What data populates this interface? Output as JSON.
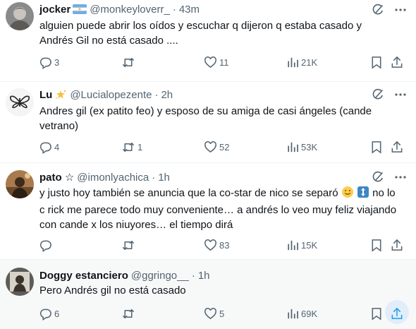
{
  "tweets": [
    {
      "name": "jocker",
      "handle": "@monkeyloverr_",
      "time": "43m",
      "text_lines": [
        "alguien puede abrir los oídos y escuchar q dijeron q estaba casado y",
        "Andrés Gil no está casado ...."
      ],
      "replies": "3",
      "reposts": "",
      "likes": "11",
      "views": "21K",
      "badge_icon": "argentina-flag-icon"
    },
    {
      "name": "Lu",
      "handle": "@Lucialopezente",
      "time": "2h",
      "text_lines": [
        "Andres gil (ex patito feo) y esposo de su amiga de casi ángeles (cande",
        "vetrano)"
      ],
      "replies": "4",
      "reposts": "1",
      "likes": "52",
      "views": "53K",
      "badge_icon": "sparkle-star-icon"
    },
    {
      "name": "pato ☆",
      "handle": "@imonlyachica",
      "time": "1h",
      "text_line1_prefix": "y justo hoy también se anuncia que la co-star de nico se separó",
      "text_line1_suffix": "no lo",
      "text_lines_rest": [
        "c rick me parece todo muy conveniente… a andrés lo veo muy feliz viajando",
        "con cande x los niuyores… el tiempo dirá"
      ],
      "replies": "",
      "reposts": "",
      "likes": "83",
      "views": "15K"
    },
    {
      "name": "Doggy estanciero",
      "handle": "@ggringo__",
      "time": "1h",
      "text_lines": [
        "Pero Andrés gil no está casado"
      ],
      "replies": "6",
      "reposts": "",
      "likes": "5",
      "views": "69K"
    }
  ],
  "separator": "·",
  "colors": {
    "text": "#0f1419",
    "secondary": "#536471",
    "divider": "#eff3f4",
    "hover_bg": "#f7f9f9",
    "accent": "#1d9bf0"
  }
}
